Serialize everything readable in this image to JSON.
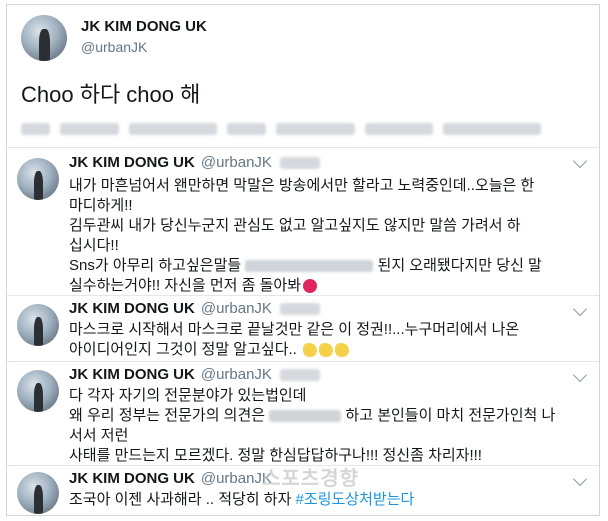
{
  "profile": {
    "name": "JK KIM DONG UK",
    "handle": "@urbanJK"
  },
  "main_tweet": {
    "text": "Choo 하다 choo 해"
  },
  "replies": [
    {
      "name": "JK KIM DONG UK",
      "handle": "@urbanJK",
      "lines": [
        "내가 마흔넘어서 왠만하면 막말은 방송에서만 할라고 노력중인데..오늘은 한",
        "마디하게!!",
        "김두관씨 내가 당신누군지 관심도 없고 알고싶지도 않지만 말씀 가려서 하",
        "십시다!!"
      ],
      "line5_a": "Sns가 아무리 하고싶은말들",
      "line5_b": "된지 오래됐다지만 당신 말",
      "line6": "실수하는거야!! 자신을 먼저 좀 돌아봐"
    },
    {
      "name": "JK KIM DONG UK",
      "handle": "@urbanJK",
      "lines": [
        "마스크로 시작해서 마스크로 끝날것만 같은 이 정권!!...누구머리에서 나온",
        "아이디어인지 그것이 정말 알고싶다.."
      ]
    },
    {
      "name": "JK KIM DONG UK",
      "handle": "@urbanJK",
      "line1": "다 각자 자기의 전문분야가 있는법인데",
      "line2_a": "왜 우리 정부는 전문가의 의견은",
      "line2_b": "하고 본인들이 마치 전문가인척 나",
      "line3": "서서 저런",
      "line4": "사태를 만드는지 모르겠다. 정말 한심답답하구나!!! 정신좀 차리자!!!"
    },
    {
      "name": "JK KIM DONG UK",
      "handle": "@urbanJK",
      "text": "조국아 이젠 사과해라 .. 적당히 하자",
      "hashtag": "#조링도상처받는다"
    }
  ],
  "watermark": "스포츠경향",
  "colors": {
    "text": "#14171a",
    "secondary": "#657786",
    "hashtag": "#1b95e0",
    "border": "#e1e8ed"
  },
  "icons": {
    "reply_menu": "chevron-down-icon",
    "emoji_angry": "angry-face-emoji",
    "emoji_clap": "clapping-hands-emoji"
  }
}
